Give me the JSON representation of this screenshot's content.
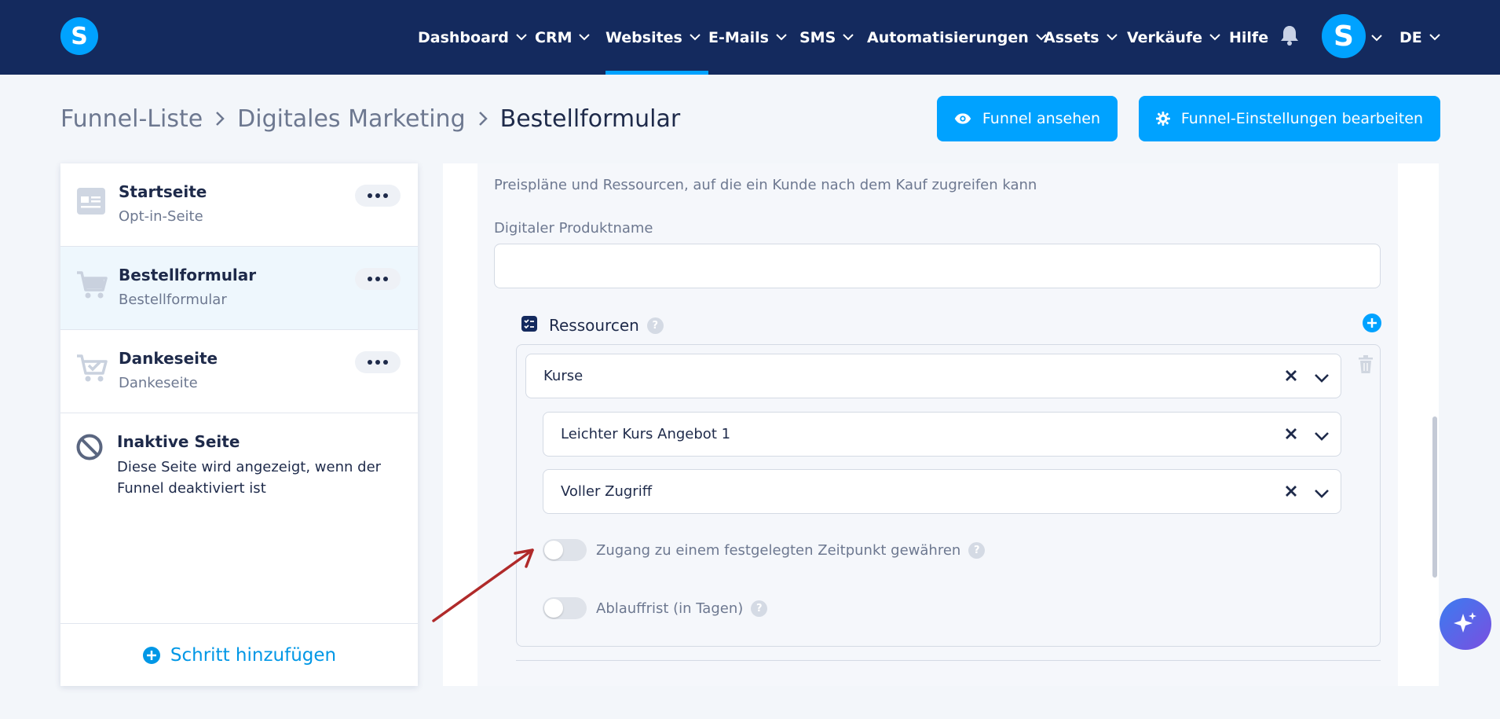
{
  "nav": {
    "items": [
      {
        "label": "Dashboard"
      },
      {
        "label": "CRM"
      },
      {
        "label": "Websites"
      },
      {
        "label": "E-Mails"
      },
      {
        "label": "SMS"
      },
      {
        "label": "Automatisierungen"
      },
      {
        "label": "Assets"
      },
      {
        "label": "Verkäufe"
      },
      {
        "label": "Hilfe"
      }
    ],
    "active": "Websites",
    "logo_letter": "S",
    "avatar_letter": "S",
    "language": "DE"
  },
  "breadcrumb": {
    "items": [
      "Funnel-Liste",
      "Digitales Marketing"
    ],
    "current": "Bestellformular"
  },
  "actions": {
    "view_funnel": "Funnel ansehen",
    "edit_settings": "Funnel-Einstellungen bearbeiten"
  },
  "sidebar": {
    "steps": [
      {
        "title": "Startseite",
        "subtitle": "Opt-in-Seite",
        "icon": "page-icon"
      },
      {
        "title": "Bestellformular",
        "subtitle": "Bestellformular",
        "icon": "cart-icon"
      },
      {
        "title": "Dankeseite",
        "subtitle": "Dankeseite",
        "icon": "cart-check-icon"
      }
    ],
    "inactive": {
      "title": "Inaktive Seite",
      "description": "Diese Seite wird angezeigt, wenn der Funnel deaktiviert ist"
    },
    "add_step": "Schritt hinzufügen"
  },
  "main": {
    "description": "Preispläne und Ressourcen, auf die ein Kunde nach dem Kauf zugreifen kann",
    "product_name_label": "Digitaler Produktname",
    "product_name_value": "",
    "resources_label": "Ressourcen",
    "resource_type": "Kurse",
    "course": "Leichter Kurs Angebot 1",
    "access": "Voller Zugriff",
    "toggle_fixed_time": {
      "label": "Zugang zu einem festgelegten Zeitpunkt gewähren",
      "on": false
    },
    "toggle_expiry": {
      "label": "Ablauffrist (in Tagen)",
      "on": false
    }
  },
  "colors": {
    "nav_bg": "#142a5e",
    "accent": "#00a2ff",
    "annotation_arrow": "#b02a2a"
  }
}
